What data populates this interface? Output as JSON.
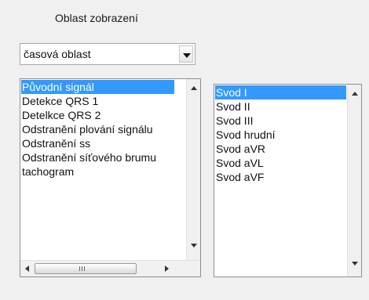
{
  "panel": {
    "title": "Oblast  zobrazení",
    "combo": {
      "value": "časová oblast"
    }
  },
  "signals": {
    "items": [
      "Původní signál",
      "Detekce QRS 1",
      "Detelkce QRS 2",
      "Odstranění plování signálu",
      "Odstranění ss",
      "Odstranění síťového brumu",
      "tachogram"
    ],
    "selected_index": 0
  },
  "leads": {
    "items": [
      "Svod I",
      "Svod II",
      "Svod III",
      "Svod hrudní",
      "Svod aVR",
      "Svod aVL",
      "Svod aVF"
    ],
    "selected_index": 0
  },
  "icons": {
    "combo": "chevron-down-icon",
    "up": "scroll-up-icon",
    "down": "scroll-down-icon",
    "left": "scroll-left-icon",
    "right": "scroll-right-icon",
    "grip": "scroll-grip-icon"
  },
  "colors": {
    "selection": "#3399ff",
    "background": "#f0f0f0"
  }
}
